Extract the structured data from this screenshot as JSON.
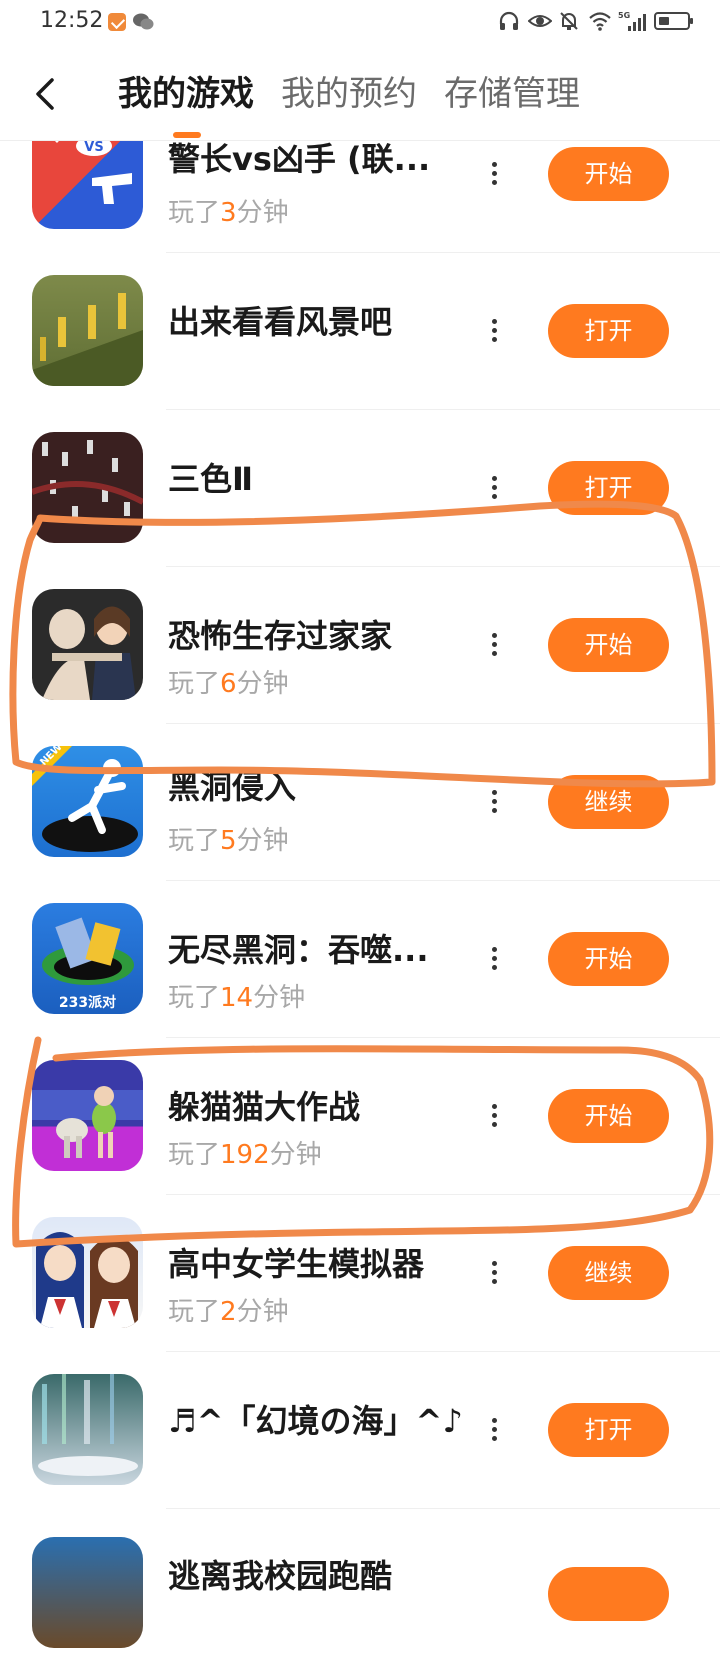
{
  "status_bar": {
    "time": "12:52",
    "left_icons": [
      "shopping-app-icon",
      "wechat-icon"
    ],
    "right_icons": [
      "headphones-icon",
      "eye-icon",
      "mute-icon",
      "wifi-icon",
      "5g-signal-icon",
      "battery-icon"
    ]
  },
  "header": {
    "tabs": [
      {
        "label": "我的游戏",
        "active": true
      },
      {
        "label": "我的预约",
        "active": false
      },
      {
        "label": "存储管理",
        "active": false
      }
    ]
  },
  "games": [
    {
      "title": "警长vs凶手 (联...",
      "played_prefix": "玩了",
      "minutes": "3",
      "played_suffix": "分钟",
      "action": "开始",
      "icon": "sheriff-vs-killer-icon"
    },
    {
      "title": "出来看看风景吧",
      "played_prefix": "",
      "minutes": "",
      "played_suffix": "",
      "action": "打开",
      "icon": "scenery-game-icon"
    },
    {
      "title": "三色Ⅱ",
      "played_prefix": "",
      "minutes": "",
      "played_suffix": "",
      "action": "打开",
      "icon": "three-colors-icon"
    },
    {
      "title": "恐怖生存过家家",
      "played_prefix": "玩了",
      "minutes": "6",
      "played_suffix": "分钟",
      "action": "开始",
      "icon": "horror-survival-icon"
    },
    {
      "title": "黑洞侵入",
      "played_prefix": "玩了",
      "minutes": "5",
      "played_suffix": "分钟",
      "action": "继续",
      "icon": "black-hole-invasion-icon"
    },
    {
      "title": "无尽黑洞：吞噬...",
      "played_prefix": "玩了",
      "minutes": "14",
      "played_suffix": "分钟",
      "action": "开始",
      "icon": "endless-black-hole-icon",
      "icon_text": "233派对"
    },
    {
      "title": "躲猫猫大作战",
      "played_prefix": "玩了",
      "minutes": "192",
      "played_suffix": "分钟",
      "action": "开始",
      "icon": "hide-and-seek-icon"
    },
    {
      "title": "高中女学生模拟器",
      "played_prefix": "玩了",
      "minutes": "2",
      "played_suffix": "分钟",
      "action": "继续",
      "icon": "high-school-girl-sim-icon"
    },
    {
      "title": "♬^「幻境の海」^♪",
      "played_prefix": "",
      "minutes": "",
      "played_suffix": "",
      "action": "打开",
      "icon": "fantasy-sea-icon"
    },
    {
      "title": "逃离我校园跑酷",
      "played_prefix": "",
      "minutes": "",
      "played_suffix": "",
      "action": "",
      "icon": "campus-parkour-icon"
    }
  ],
  "colors": {
    "accent": "#ff7a1f",
    "annotation": "#f0894a"
  }
}
